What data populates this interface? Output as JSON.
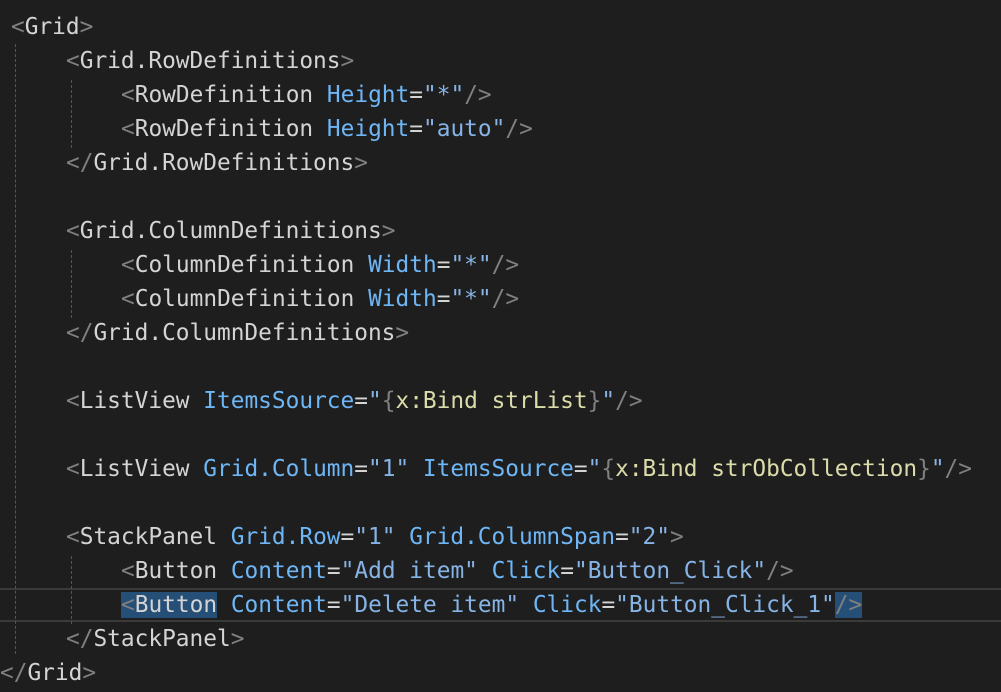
{
  "editor": {
    "theme": {
      "background": "#1e1e1e",
      "punctuation": "#808080",
      "element": "#d4d4d4",
      "attribute": "#6eb6f6",
      "string": "#87b4e6",
      "extension": "#dcdcaa",
      "selection": "#264f78"
    },
    "lines": [
      {
        "indent": 1,
        "segments": [
          {
            "t": "pu",
            "v": "<"
          },
          {
            "t": "el",
            "v": "Grid"
          },
          {
            "t": "pu",
            "v": ">"
          }
        ]
      },
      {
        "indent": 2,
        "segments": [
          {
            "t": "pu",
            "v": "<"
          },
          {
            "t": "el",
            "v": "Grid.RowDefinitions"
          },
          {
            "t": "pu",
            "v": ">"
          }
        ]
      },
      {
        "indent": 3,
        "segments": [
          {
            "t": "pu",
            "v": "<"
          },
          {
            "t": "el",
            "v": "RowDefinition"
          },
          {
            "t": "el",
            "v": " "
          },
          {
            "t": "at",
            "v": "Height"
          },
          {
            "t": "eq",
            "v": "="
          },
          {
            "t": "st",
            "v": "\"*\""
          },
          {
            "t": "pu",
            "v": "/>"
          }
        ]
      },
      {
        "indent": 3,
        "segments": [
          {
            "t": "pu",
            "v": "<"
          },
          {
            "t": "el",
            "v": "RowDefinition"
          },
          {
            "t": "el",
            "v": " "
          },
          {
            "t": "at",
            "v": "Height"
          },
          {
            "t": "eq",
            "v": "="
          },
          {
            "t": "st",
            "v": "\"auto\""
          },
          {
            "t": "pu",
            "v": "/>"
          }
        ]
      },
      {
        "indent": 2,
        "segments": [
          {
            "t": "pu",
            "v": "</"
          },
          {
            "t": "el",
            "v": "Grid.RowDefinitions"
          },
          {
            "t": "pu",
            "v": ">"
          }
        ]
      },
      {
        "indent": 0,
        "segments": []
      },
      {
        "indent": 2,
        "segments": [
          {
            "t": "pu",
            "v": "<"
          },
          {
            "t": "el",
            "v": "Grid.ColumnDefinitions"
          },
          {
            "t": "pu",
            "v": ">"
          }
        ]
      },
      {
        "indent": 3,
        "segments": [
          {
            "t": "pu",
            "v": "<"
          },
          {
            "t": "el",
            "v": "ColumnDefinition"
          },
          {
            "t": "el",
            "v": " "
          },
          {
            "t": "at",
            "v": "Width"
          },
          {
            "t": "eq",
            "v": "="
          },
          {
            "t": "st",
            "v": "\"*\""
          },
          {
            "t": "pu",
            "v": "/>"
          }
        ]
      },
      {
        "indent": 3,
        "segments": [
          {
            "t": "pu",
            "v": "<"
          },
          {
            "t": "el",
            "v": "ColumnDefinition"
          },
          {
            "t": "el",
            "v": " "
          },
          {
            "t": "at",
            "v": "Width"
          },
          {
            "t": "eq",
            "v": "="
          },
          {
            "t": "st",
            "v": "\"*\""
          },
          {
            "t": "pu",
            "v": "/>"
          }
        ]
      },
      {
        "indent": 2,
        "segments": [
          {
            "t": "pu",
            "v": "</"
          },
          {
            "t": "el",
            "v": "Grid.ColumnDefinitions"
          },
          {
            "t": "pu",
            "v": ">"
          }
        ]
      },
      {
        "indent": 0,
        "segments": []
      },
      {
        "indent": 2,
        "segments": [
          {
            "t": "pu",
            "v": "<"
          },
          {
            "t": "el",
            "v": "ListView"
          },
          {
            "t": "el",
            "v": " "
          },
          {
            "t": "at",
            "v": "ItemsSource"
          },
          {
            "t": "eq",
            "v": "="
          },
          {
            "t": "st",
            "v": "\""
          },
          {
            "t": "pu",
            "v": "{"
          },
          {
            "t": "ext",
            "v": "x:Bind"
          },
          {
            "t": "el",
            "v": " "
          },
          {
            "t": "ext",
            "v": "strList"
          },
          {
            "t": "pu",
            "v": "}"
          },
          {
            "t": "st",
            "v": "\""
          },
          {
            "t": "pu",
            "v": "/>"
          }
        ]
      },
      {
        "indent": 0,
        "segments": []
      },
      {
        "indent": 2,
        "segments": [
          {
            "t": "pu",
            "v": "<"
          },
          {
            "t": "el",
            "v": "ListView"
          },
          {
            "t": "el",
            "v": " "
          },
          {
            "t": "at",
            "v": "Grid.Column"
          },
          {
            "t": "eq",
            "v": "="
          },
          {
            "t": "st",
            "v": "\"1\""
          },
          {
            "t": "el",
            "v": " "
          },
          {
            "t": "at",
            "v": "ItemsSource"
          },
          {
            "t": "eq",
            "v": "="
          },
          {
            "t": "st",
            "v": "\""
          },
          {
            "t": "pu",
            "v": "{"
          },
          {
            "t": "ext",
            "v": "x:Bind"
          },
          {
            "t": "el",
            "v": " "
          },
          {
            "t": "ext",
            "v": "strObCollection"
          },
          {
            "t": "pu",
            "v": "}"
          },
          {
            "t": "st",
            "v": "\""
          },
          {
            "t": "pu",
            "v": "/>"
          }
        ]
      },
      {
        "indent": 0,
        "segments": []
      },
      {
        "indent": 2,
        "segments": [
          {
            "t": "pu",
            "v": "<"
          },
          {
            "t": "el",
            "v": "StackPanel"
          },
          {
            "t": "el",
            "v": " "
          },
          {
            "t": "at",
            "v": "Grid.Row"
          },
          {
            "t": "eq",
            "v": "="
          },
          {
            "t": "st",
            "v": "\"1\""
          },
          {
            "t": "el",
            "v": " "
          },
          {
            "t": "at",
            "v": "Grid.ColumnSpan"
          },
          {
            "t": "eq",
            "v": "="
          },
          {
            "t": "st",
            "v": "\"2\""
          },
          {
            "t": "pu",
            "v": ">"
          }
        ]
      },
      {
        "indent": 3,
        "segments": [
          {
            "t": "pu",
            "v": "<"
          },
          {
            "t": "el",
            "v": "Button"
          },
          {
            "t": "el",
            "v": " "
          },
          {
            "t": "at",
            "v": "Content"
          },
          {
            "t": "eq",
            "v": "="
          },
          {
            "t": "st",
            "v": "\"Add item\""
          },
          {
            "t": "el",
            "v": " "
          },
          {
            "t": "at",
            "v": "Click"
          },
          {
            "t": "eq",
            "v": "="
          },
          {
            "t": "st",
            "v": "\"Button_Click\""
          },
          {
            "t": "pu",
            "v": "/>"
          }
        ]
      },
      {
        "indent": 3,
        "segments": [
          {
            "t": "pu",
            "v": "<",
            "hl": true
          },
          {
            "t": "el",
            "v": "Button",
            "hl": true
          },
          {
            "t": "el",
            "v": " "
          },
          {
            "t": "at",
            "v": "Content"
          },
          {
            "t": "eq",
            "v": "="
          },
          {
            "t": "st",
            "v": "\"Delete item\""
          },
          {
            "t": "el",
            "v": " "
          },
          {
            "t": "at",
            "v": "Click"
          },
          {
            "t": "eq",
            "v": "="
          },
          {
            "t": "st",
            "v": "\"Button_Click_1\""
          },
          {
            "t": "pu",
            "v": "/>",
            "hl": true
          }
        ]
      },
      {
        "indent": 2,
        "segments": [
          {
            "t": "pu",
            "v": "</"
          },
          {
            "t": "el",
            "v": "StackPanel"
          },
          {
            "t": "pu",
            "v": ">"
          }
        ]
      },
      {
        "indent": 0,
        "segments": [
          {
            "t": "pu",
            "v": "</"
          },
          {
            "t": "el",
            "v": "Grid"
          },
          {
            "t": "pu",
            "v": ">"
          }
        ]
      }
    ]
  }
}
